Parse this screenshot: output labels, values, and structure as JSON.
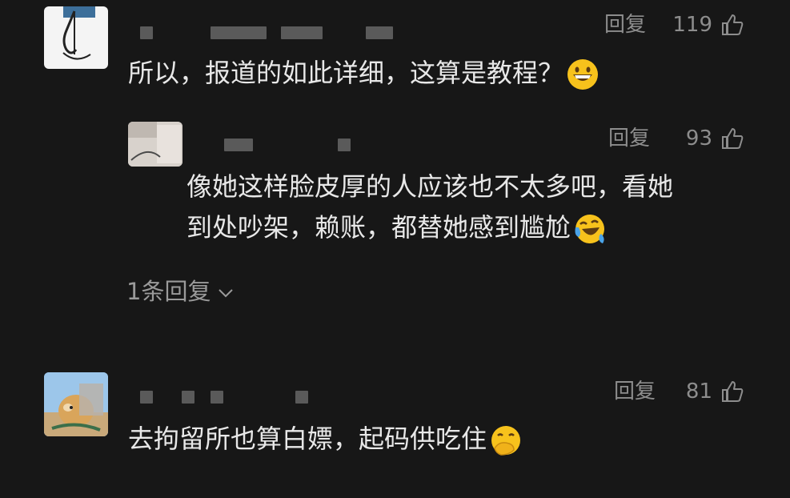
{
  "colors": {
    "background": "#171717",
    "text": "#e8e8e8",
    "meta": "#8d8d8d"
  },
  "comments": [
    {
      "reply_label": "回复",
      "likes": "119",
      "text": "所以，报道的如此详细，这算是教程？",
      "emoji": "grinning-face-emoji"
    },
    {
      "reply_label": "回复",
      "likes": "93",
      "line1": "像她这样脸皮厚的人应该也不太多吧，看她",
      "line2": "到处吵架，赖账，都替她感到尴尬",
      "emoji": "crying-laughing-face-emoji"
    },
    {
      "reply_label": "回复",
      "likes": "81",
      "text": "去拘留所也算白嫖，起码供吃住",
      "emoji": "thinking-hand-over-mouth-emoji"
    }
  ],
  "expand_replies": {
    "label": "1条回复",
    "icon": "chevron-down-icon"
  }
}
